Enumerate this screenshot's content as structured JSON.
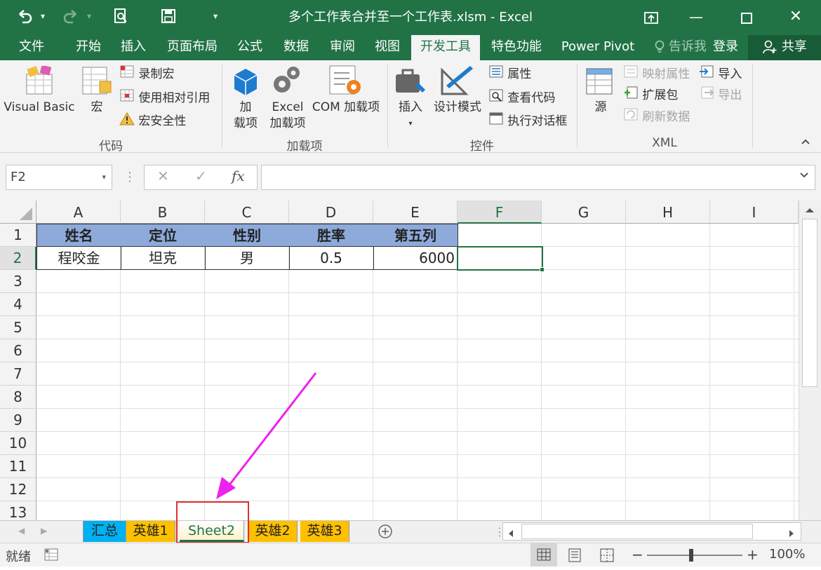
{
  "window": {
    "title": "多个工作表合并至一个工作表.xlsm - Excel"
  },
  "quick_access": {
    "undo_icon": "undo-icon",
    "redo_icon": "redo-icon",
    "print_preview_icon": "print-preview-icon",
    "save_icon": "save-icon",
    "customize_icon": "customize-icon"
  },
  "menu": {
    "tabs": [
      "文件",
      "开始",
      "插入",
      "页面布局",
      "公式",
      "数据",
      "审阅",
      "视图",
      "开发工具",
      "特色功能",
      "Power Pivot"
    ],
    "active_tab": "开发工具",
    "tell_me": "告诉我",
    "login": "登录",
    "share": "共享"
  },
  "ribbon": {
    "code": {
      "label": "代码",
      "visual_basic": "Visual Basic",
      "macro": "宏",
      "record_macro": "录制宏",
      "relative_ref": "使用相对引用",
      "macro_security": "宏安全性"
    },
    "addins": {
      "label": "加载项",
      "addins_l1": "加",
      "addins_l2": "载项",
      "excel_addins_l1": "Excel",
      "excel_addins_l2": "加载项",
      "com_addins": "COM 加载项"
    },
    "controls": {
      "label": "控件",
      "insert": "插入",
      "design_mode": "设计模式",
      "properties": "属性",
      "view_code": "查看代码",
      "run_dialog": "执行对话框"
    },
    "xml": {
      "label": "XML",
      "source": "源",
      "map_props": "映射属性",
      "expansion": "扩展包",
      "refresh": "刷新数据",
      "import": "导入",
      "export": "导出"
    }
  },
  "formula_bar": {
    "name_box": "F2",
    "cancel": "✕",
    "enter": "✓",
    "fx": "fx",
    "formula": ""
  },
  "columns": [
    "A",
    "B",
    "C",
    "D",
    "E",
    "F",
    "G",
    "H",
    "I"
  ],
  "selected_column": "F",
  "rows": [
    "1",
    "2",
    "3",
    "4",
    "5",
    "6",
    "7",
    "8",
    "9",
    "10",
    "11",
    "12",
    "13"
  ],
  "selected_row": "2",
  "header_row": [
    "姓名",
    "定位",
    "性别",
    "胜率",
    "第五列"
  ],
  "data_row": [
    "程咬金",
    "坦克",
    "男",
    "0.5",
    "6000"
  ],
  "sheets": [
    {
      "name": "汇总",
      "color": "#00b0f0"
    },
    {
      "name": "英雄1",
      "color": "#ffc000"
    },
    {
      "name": "Sheet2",
      "color": "#fff2cc"
    },
    {
      "name": "英雄2",
      "color": "#ffc000"
    },
    {
      "name": "英雄3",
      "color": "#ffc000"
    }
  ],
  "active_sheet": "Sheet2",
  "annotation": {
    "arrow_color": "#ee22ee",
    "highlight_color": "#e03030"
  },
  "status": {
    "ready": "就绪",
    "zoom": "100%"
  }
}
